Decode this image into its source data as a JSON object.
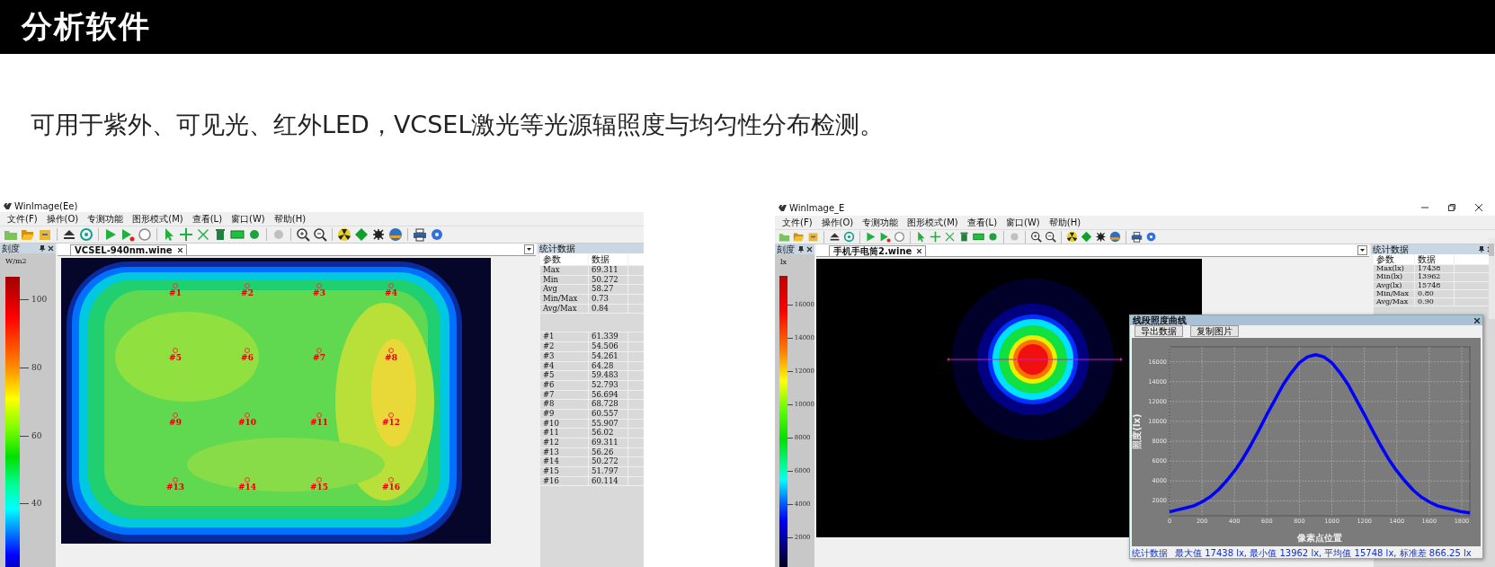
{
  "header": {
    "title": "分析软件"
  },
  "description": "可用于紫外、可见光、红外LED，VCSEL激光等光源辐照度与均匀性分布检测。",
  "apps": [
    {
      "title": "WinImage(Ee)",
      "window_controls": false,
      "menu": [
        "文件(F)",
        "操作(O)",
        "专测功能",
        "图形模式(M)",
        "查看(L)",
        "窗口(W)",
        "帮助(H)"
      ],
      "scale": {
        "title": "刻度",
        "unit": "W/m2",
        "ticks": [
          "100",
          "80",
          "60",
          "40"
        ]
      },
      "document": {
        "tab": "VCSEL-940nm.wine",
        "kind": "grid-heatmap",
        "markers": [
          "#1",
          "#2",
          "#3",
          "#4",
          "#5",
          "#6",
          "#7",
          "#8",
          "#9",
          "#10",
          "#11",
          "#12",
          "#13",
          "#14",
          "#15",
          "#16"
        ]
      },
      "stats": {
        "title": "统计数据",
        "pin_controls": false,
        "columns": [
          "参数",
          "数据"
        ],
        "groups": [
          [
            [
              "Max",
              "69.311"
            ],
            [
              "Min",
              "50.272"
            ],
            [
              "Avg",
              "58.27"
            ],
            [
              "Min/Max",
              "0.73"
            ],
            [
              "Avg/Max",
              "0.84"
            ]
          ],
          [
            [
              "#1",
              "61.339"
            ],
            [
              "#2",
              "54.506"
            ],
            [
              "#3",
              "54.261"
            ],
            [
              "#4",
              "64.28"
            ],
            [
              "#5",
              "59.483"
            ],
            [
              "#6",
              "52.793"
            ],
            [
              "#7",
              "56.694"
            ],
            [
              "#8",
              "68.728"
            ],
            [
              "#9",
              "60.557"
            ],
            [
              "#10",
              "55.907"
            ],
            [
              "#11",
              "56.02"
            ],
            [
              "#12",
              "69.311"
            ],
            [
              "#13",
              "56.26"
            ],
            [
              "#14",
              "50.272"
            ],
            [
              "#15",
              "51.797"
            ],
            [
              "#16",
              "60.114"
            ]
          ]
        ]
      }
    },
    {
      "title": "WinImage_E",
      "window_controls": true,
      "menu": [
        "文件(F)",
        "操作(O)",
        "专测功能",
        "图形模式(M)",
        "查看(L)",
        "窗口(W)",
        "帮助(H)"
      ],
      "scale": {
        "title": "刻度",
        "unit": "lx",
        "ticks": [
          "16000",
          "14000",
          "12000",
          "10000",
          "8000",
          "6000",
          "4000",
          "2000"
        ]
      },
      "document": {
        "tab": "手机手电筒2.wine",
        "kind": "spot",
        "profile_line": true
      },
      "stats": {
        "title": "统计数据",
        "pin_controls": true,
        "columns": [
          "参数",
          "数据"
        ],
        "groups": [
          [
            [
              "Max(lx)",
              "17438"
            ],
            [
              "Min(lx)",
              "13962"
            ],
            [
              "Avg(lx)",
              "15748"
            ],
            [
              "Min/Max",
              "0.80"
            ],
            [
              "Avg/Max",
              "0.90"
            ]
          ]
        ]
      },
      "chart_window": {
        "title": "线段照度曲线",
        "buttons": [
          "导出数据",
          "复制图片"
        ],
        "chart_data": {
          "type": "line",
          "xlabel": "像素点位置",
          "ylabel": "照度(lx)",
          "x": [
            0,
            50,
            100,
            150,
            200,
            250,
            300,
            350,
            400,
            450,
            500,
            550,
            600,
            650,
            700,
            750,
            800,
            850,
            900,
            950,
            1000,
            1050,
            1100,
            1150,
            1200,
            1250,
            1300,
            1350,
            1400,
            1450,
            1500,
            1550,
            1600,
            1650,
            1700,
            1750,
            1800,
            1850
          ],
          "series": [
            {
              "color": "#0000ff",
              "values": [
                900,
                1100,
                1300,
                1500,
                1900,
                2400,
                3100,
                4000,
                5000,
                6200,
                7600,
                9100,
                10700,
                12200,
                13700,
                14900,
                15900,
                16500,
                16700,
                16500,
                15900,
                14900,
                13700,
                12200,
                10700,
                9100,
                7600,
                6200,
                5000,
                4000,
                3100,
                2400,
                1900,
                1500,
                1300,
                1100,
                900,
                800
              ]
            }
          ],
          "grid": true,
          "xlim": [
            0,
            1850
          ],
          "ylim": [
            500,
            17500
          ],
          "xticks": [
            0,
            200,
            400,
            600,
            800,
            1000,
            1200,
            1400,
            1600,
            1800
          ],
          "yticks": [
            2000,
            4000,
            6000,
            8000,
            10000,
            12000,
            14000,
            16000
          ]
        },
        "status_label": "统计数据",
        "status_text": "最大值 17438 lx, 最小值 13962 lx, 平均值 15748 lx, 标准差 866.25 lx"
      }
    }
  ]
}
